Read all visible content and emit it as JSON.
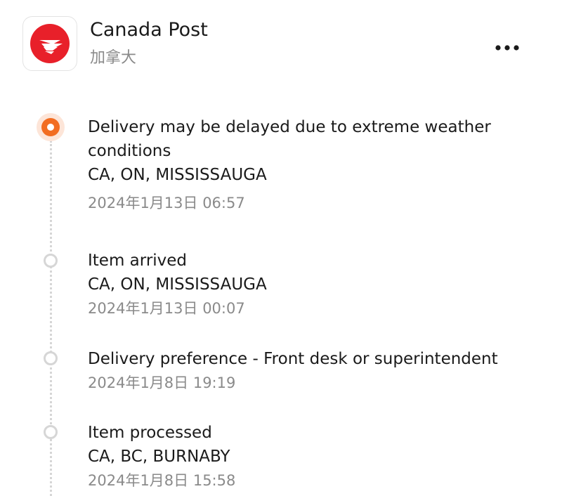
{
  "header": {
    "carrier_name": "Canada Post",
    "carrier_subtitle": "加拿大",
    "logo_icon": "canada-post-logo",
    "more_icon": "more-horizontal-icon",
    "more_glyph": "•••",
    "colors": {
      "logo_red": "#e8202a",
      "accent_orange": "#f26d21"
    }
  },
  "events": [
    {
      "status": "Delivery may be delayed due to extreme weather conditions",
      "location": "CA, ON, MISSISSAUGA",
      "time": "2024年1月13日 06:57",
      "current": true
    },
    {
      "status": "Item arrived",
      "location": "CA, ON, MISSISSAUGA",
      "time": "2024年1月13日 00:07",
      "current": false
    },
    {
      "status": "Delivery preference - Front desk or superintendent",
      "location": "",
      "time": "2024年1月8日 19:19",
      "current": false
    },
    {
      "status": "Item processed",
      "location": "CA, BC, BURNABY",
      "time": "2024年1月8日 15:58",
      "current": false
    }
  ]
}
